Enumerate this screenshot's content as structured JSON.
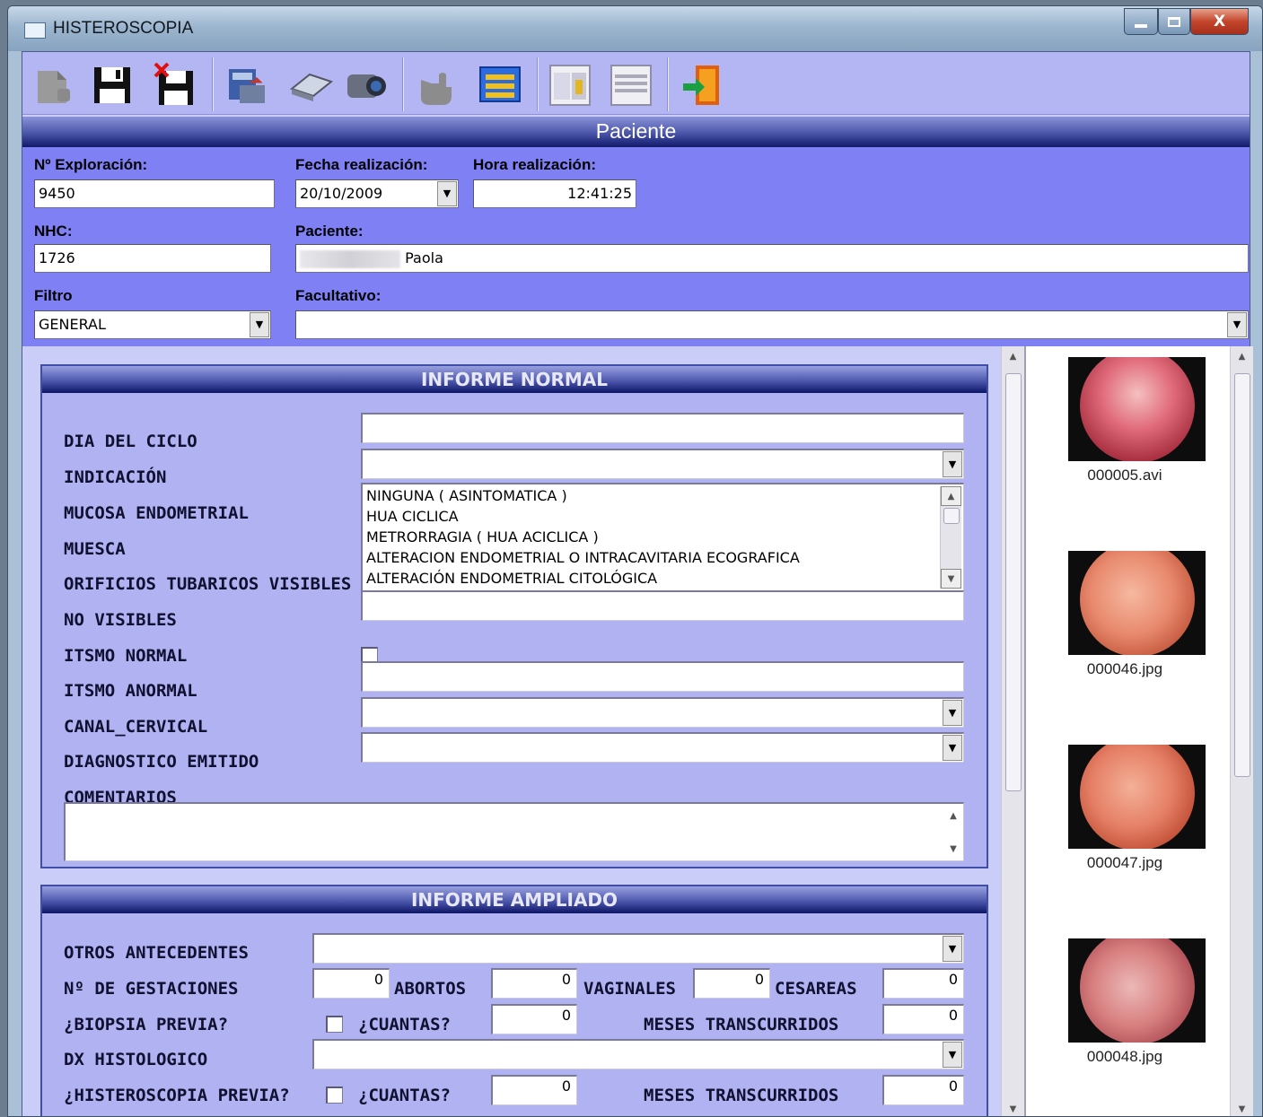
{
  "window": {
    "title": "HISTEROSCOPIA",
    "close_glyph": "X"
  },
  "toolbar": {
    "buttons": [
      {
        "name": "new-icon"
      },
      {
        "name": "save-icon"
      },
      {
        "name": "save-cancel-icon"
      },
      {
        "name": "export-icon"
      },
      {
        "name": "scanner-icon"
      },
      {
        "name": "camera-icon"
      },
      {
        "name": "hand-icon"
      },
      {
        "name": "form-icon"
      },
      {
        "name": "window-tile-icon"
      },
      {
        "name": "window-list-icon"
      },
      {
        "name": "exit-door-icon"
      }
    ]
  },
  "section_header": "Paciente",
  "patient": {
    "exploracion_label": "Nº Exploración:",
    "exploracion_value": "9450",
    "fecha_label": "Fecha realización:",
    "fecha_value": "20/10/2009",
    "hora_label": "Hora realización:",
    "hora_value": "12:41:25",
    "nhc_label": "NHC:",
    "nhc_value": "1726",
    "paciente_label": "Paciente:",
    "paciente_value": "Paola",
    "filtro_label": "Filtro",
    "filtro_value": "GENERAL",
    "facultativo_label": "Facultativo:",
    "facultativo_value": ""
  },
  "informe_normal": {
    "title": "INFORME NORMAL",
    "labels": {
      "dia_ciclo": "DIA DEL CICLO",
      "indicacion": "INDICACIÓN",
      "mucosa": "MUCOSA ENDOMETRIAL",
      "muesca": "MUESCA",
      "orificios": "ORIFICIOS TUBARICOS VISIBLES",
      "no_visibles": "NO VISIBLES",
      "itsmo_normal": "ITSMO NORMAL",
      "itsmo_anormal": "ITSMO ANORMAL",
      "canal_cervical": "CANAL_CERVICAL",
      "diagnostico": "DIAGNOSTICO EMITIDO",
      "comentarios": "COMENTARIOS"
    },
    "indicacion_options": [
      "NINGUNA ( ASINTOMATICA )",
      "HUA CICLICA",
      "METRORRAGIA ( HUA ACICLICA )",
      "ALTERACION ENDOMETRIAL O INTRACAVITARIA ECOGRAFICA",
      "ALTERACIÓN ENDOMETRIAL CITOLÓGICA"
    ]
  },
  "informe_ampliado": {
    "title": "INFORME AMPLIADO",
    "otros_antecedentes": "OTROS ANTECEDENTES",
    "gestaciones_label": "Nº DE GESTACIONES",
    "gestaciones_value": "0",
    "abortos_label": "ABORTOS",
    "abortos_value": "0",
    "vaginales_label": "VAGINALES",
    "vaginales_value": "0",
    "cesareas_label": "CESAREAS",
    "cesareas_value": "0",
    "biopsia_label": "¿BIOPSIA PREVIA?",
    "cuantas_label": "¿CUANTAS?",
    "biopsia_cuantas_value": "0",
    "meses_label": "MESES TRANSCURRIDOS",
    "biopsia_meses_value": "0",
    "dx_label": "DX HISTOLOGICO",
    "histeroscopia_label": "¿HISTEROSCOPIA PREVIA?",
    "hist_cuantas_value": "0",
    "hist_meses_value": "0"
  },
  "media": [
    {
      "filename": "000005.avi"
    },
    {
      "filename": "000046.jpg"
    },
    {
      "filename": "000047.jpg"
    },
    {
      "filename": "000048.jpg"
    }
  ],
  "colors": {
    "toolbar_bg": "#b4b6f4",
    "patient_bg": "#7f80f4",
    "panel_bg": "#b0b2f1",
    "header_dark": "#10186a"
  }
}
